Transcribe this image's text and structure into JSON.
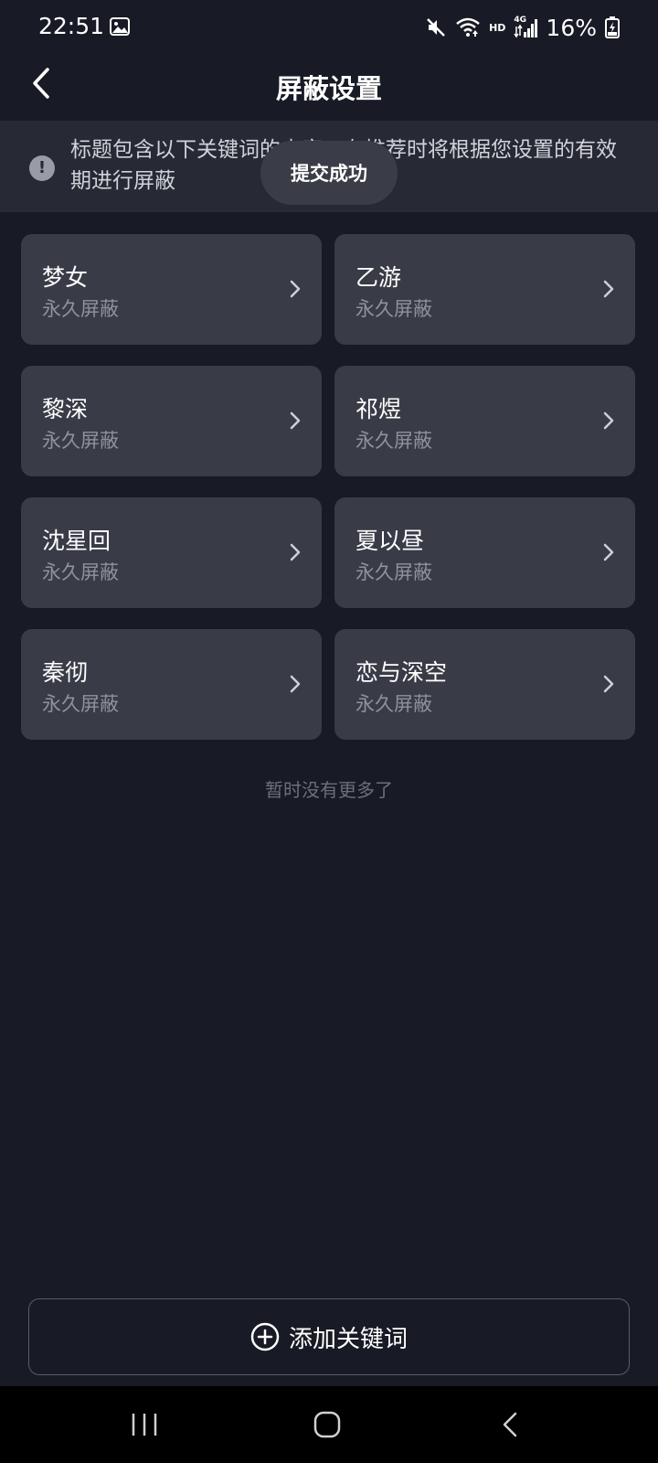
{
  "status_bar": {
    "time": "22:51",
    "hd_label": "HD",
    "network_label": "4G",
    "battery": "16%",
    "icons": [
      "gallery-icon",
      "mute-icon",
      "wifi-icon",
      "signal-icon",
      "battery-charging-icon"
    ]
  },
  "header": {
    "title": "屏蔽设置"
  },
  "notice": {
    "text": "标题包含以下关键词的内容，在推荐时将根据您设置的有效期进行屏蔽"
  },
  "toast": {
    "text": "提交成功"
  },
  "keywords": [
    {
      "word": "梦女",
      "duration": "永久屏蔽"
    },
    {
      "word": "乙游",
      "duration": "永久屏蔽"
    },
    {
      "word": "黎深",
      "duration": "永久屏蔽"
    },
    {
      "word": "祁煜",
      "duration": "永久屏蔽"
    },
    {
      "word": "沈星回",
      "duration": "永久屏蔽"
    },
    {
      "word": "夏以昼",
      "duration": "永久屏蔽"
    },
    {
      "word": "秦彻",
      "duration": "永久屏蔽"
    },
    {
      "word": "恋与深空",
      "duration": "永久屏蔽"
    }
  ],
  "end_text": "暂时没有更多了",
  "add_button": {
    "label": "添加关键词"
  },
  "colors": {
    "background": "#181a25",
    "card": "#393b47",
    "notice": "#272a35",
    "subtext": "#8f919b"
  }
}
